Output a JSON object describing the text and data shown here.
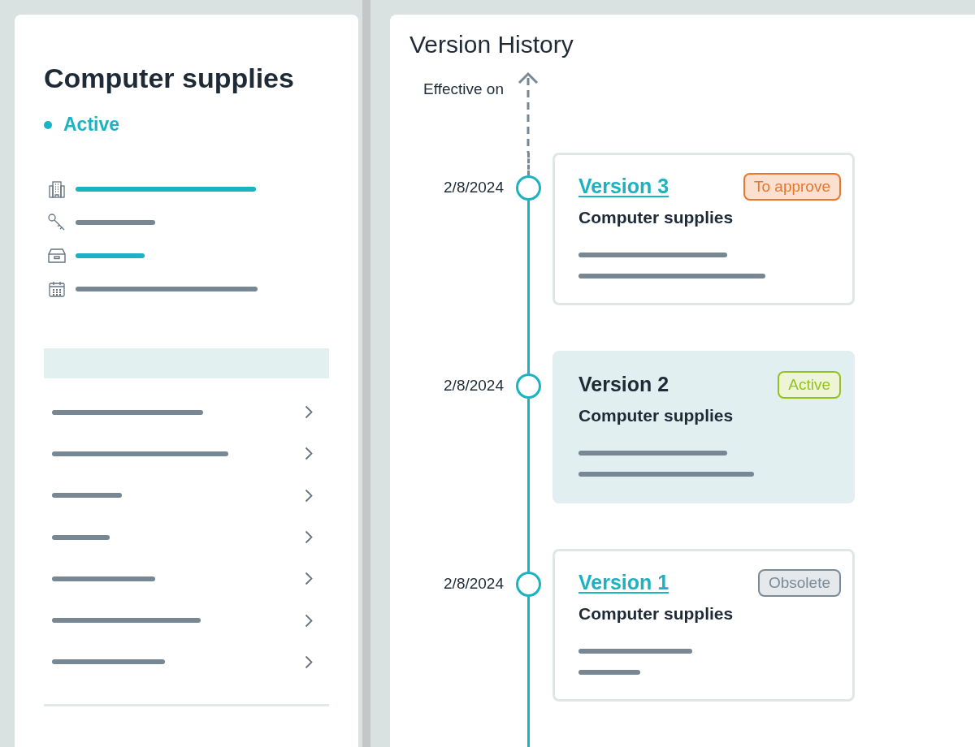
{
  "record": {
    "title": "Computer supplies",
    "status": {
      "label": "Active",
      "color": "#1bb3c1"
    }
  },
  "info_rows": [
    {
      "kind": "building",
      "color": "#1bb3c1"
    },
    {
      "kind": "key",
      "color": "#778794"
    },
    {
      "kind": "archive",
      "color": "#1bb3c1"
    },
    {
      "kind": "calendar",
      "color": "#778794"
    }
  ],
  "nav_rows": [
    {
      "kind": "link"
    },
    {
      "kind": "link"
    },
    {
      "kind": "link"
    },
    {
      "kind": "link"
    },
    {
      "kind": "link"
    },
    {
      "kind": "link"
    },
    {
      "kind": "link"
    }
  ],
  "history": {
    "title": "Version History",
    "axis_label": "Effective on",
    "versions": [
      {
        "date": "2/8/2024",
        "title": "Version 3",
        "subtitle": "Computer supplies",
        "badge": {
          "label": "To approve",
          "kind": "pending"
        },
        "selected": false
      },
      {
        "date": "2/8/2024",
        "title": "Version 2",
        "subtitle": "Computer supplies",
        "badge": {
          "label": "Active",
          "kind": "active"
        },
        "selected": true
      },
      {
        "date": "2/8/2024",
        "title": "Version 1",
        "subtitle": "Computer supplies",
        "badge": {
          "label": "Obsolete",
          "kind": "obsolete"
        },
        "selected": false
      }
    ]
  }
}
